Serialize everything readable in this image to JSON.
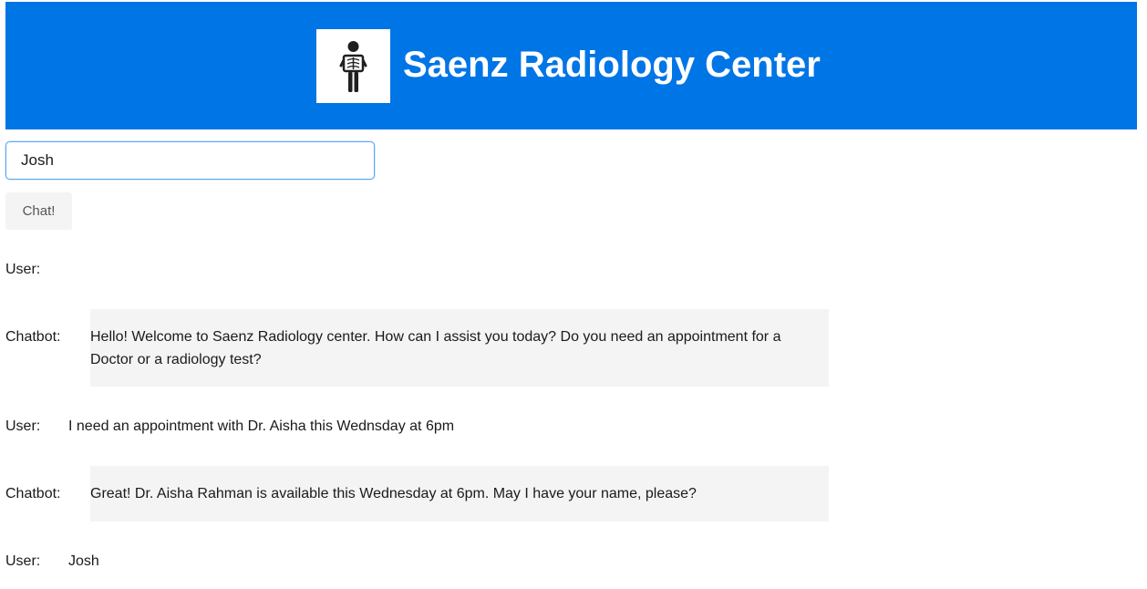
{
  "header": {
    "title": "Saenz Radiology Center",
    "background_color": "#0075e6",
    "logo_icon": "xray-person-icon"
  },
  "form": {
    "name_value": "Josh",
    "chat_button_label": "Chat!"
  },
  "conversation": [
    {
      "speaker": "User:",
      "text": ""
    },
    {
      "speaker": "Chatbot:",
      "text": "Hello! Welcome to Saenz Radiology center. How can I assist you today? Do you need an appointment for a Doctor or a radiology test?"
    },
    {
      "speaker": "User:",
      "text": "I need an appointment with Dr. Aisha this Wednsday at 6pm"
    },
    {
      "speaker": "Chatbot:",
      "text": "Great! Dr. Aisha Rahman is available this Wednesday at 6pm. May I have your name, please?"
    },
    {
      "speaker": "User:",
      "text": "Josh"
    }
  ]
}
